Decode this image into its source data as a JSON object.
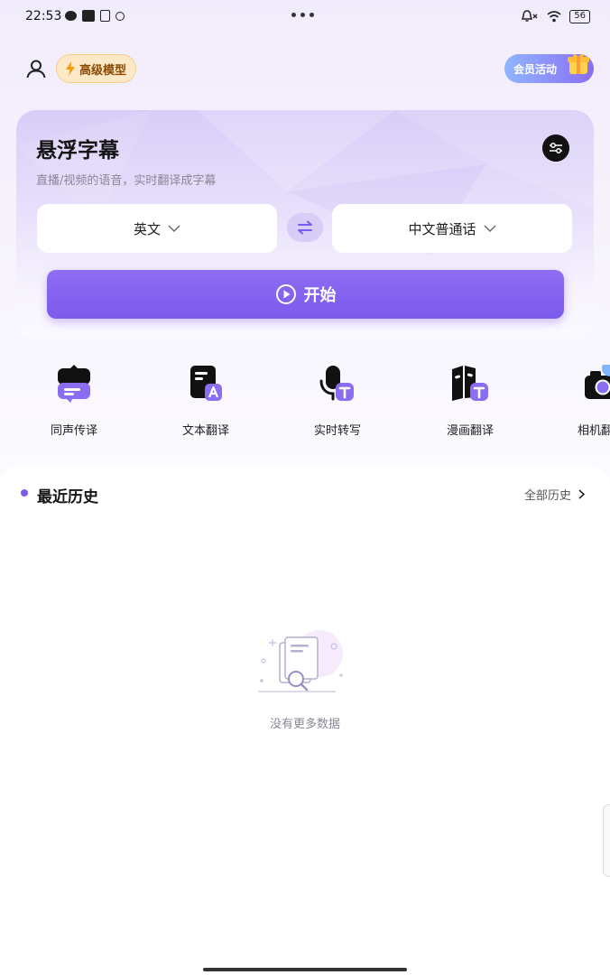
{
  "status_bar": {
    "time": "22:53",
    "battery": "56",
    "icons": [
      "wechat-icon",
      "nfc-icon",
      "clipboard-icon",
      "record-icon",
      "more-dots-icon",
      "bell-muted-icon",
      "wifi-icon",
      "battery-icon"
    ]
  },
  "header": {
    "pro_label": "高级模型",
    "member_label": "会员活动"
  },
  "card": {
    "title": "悬浮字幕",
    "subtitle": "直播/视频的语音，实时翻译成字幕",
    "source_lang": "英文",
    "target_lang": "中文普通话",
    "start_label": "开始"
  },
  "tools": [
    {
      "label": "同声传译",
      "icon": "chat-bubble-icon"
    },
    {
      "label": "文本翻译",
      "icon": "document-translate-icon"
    },
    {
      "label": "实时转写",
      "icon": "mic-transcribe-icon"
    },
    {
      "label": "漫画翻译",
      "icon": "comic-translate-icon"
    },
    {
      "label": "相机翻译",
      "icon": "camera-icon"
    }
  ],
  "history": {
    "title": "最近历史",
    "all_label": "全部历史",
    "empty_text": "没有更多数据"
  },
  "colors": {
    "accent": "#7c5aec",
    "badge_bg": "#fde9c8",
    "badge_text": "#8a4a00"
  }
}
